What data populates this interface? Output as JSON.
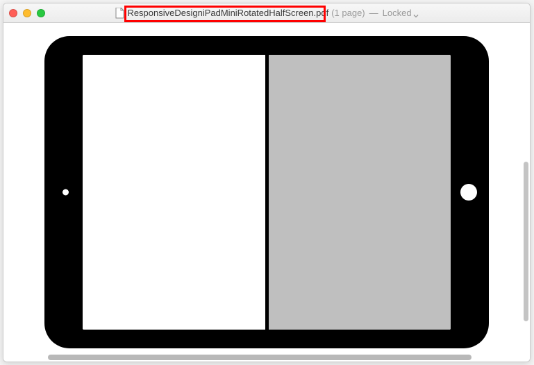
{
  "titlebar": {
    "filename": "ResponsiveDesigniPadMiniRotatedHalfScreen.pdf",
    "page_info": "(1 page)",
    "separator": "—",
    "locked_label": "Locked"
  },
  "colors": {
    "highlight_border": "#ff0000",
    "device_body": "#000000",
    "screen_right_panel": "#bfbfbf"
  }
}
